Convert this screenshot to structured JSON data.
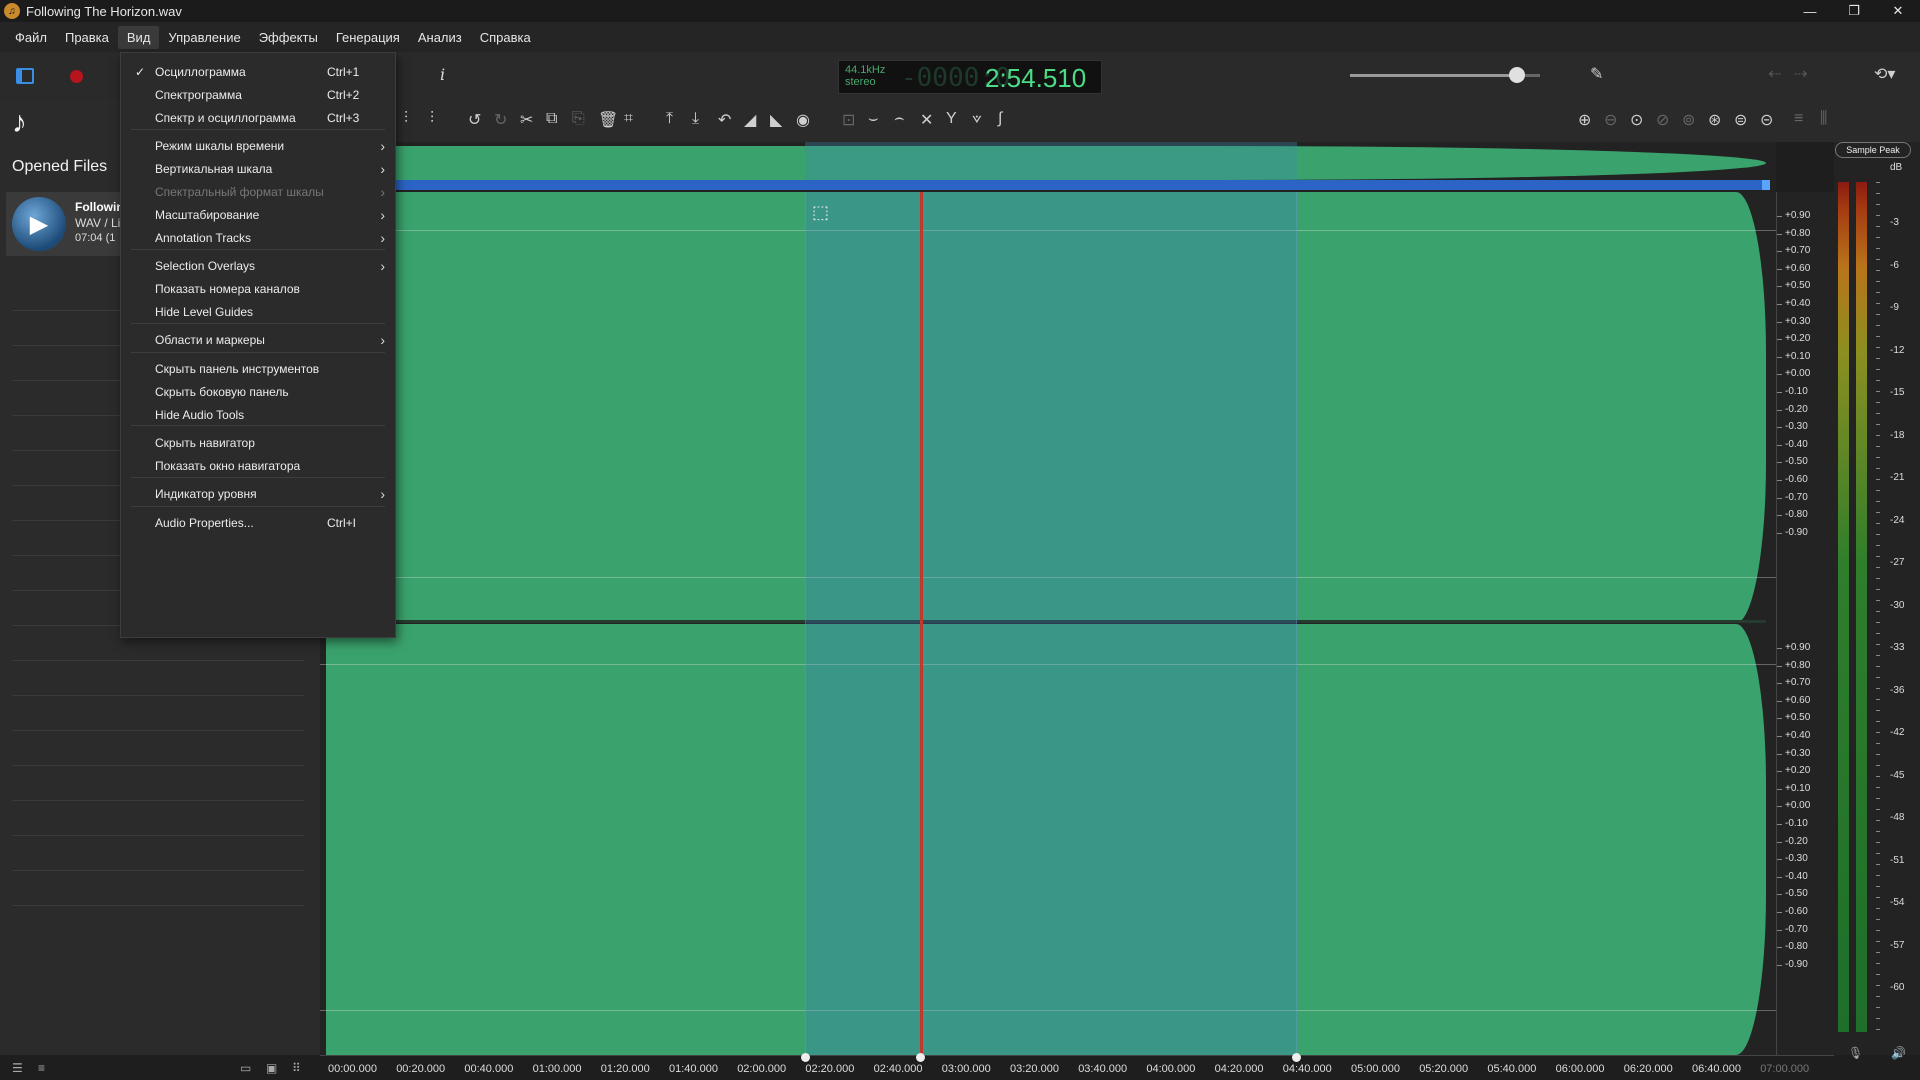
{
  "window": {
    "title": "Following The Horizon.wav",
    "buttons": [
      "—",
      "❐",
      "✕"
    ]
  },
  "menubar": {
    "items": [
      "Файл",
      "Правка",
      "Вид",
      "Управление",
      "Эффекты",
      "Генерация",
      "Анализ",
      "Справка"
    ]
  },
  "view_menu": {
    "items": [
      {
        "label": "Осциллограмма",
        "shortcut": "Ctrl+1",
        "checked": true
      },
      {
        "label": "Спектрограмма",
        "shortcut": "Ctrl+2"
      },
      {
        "label": "Спектр и осциллограмма",
        "shortcut": "Ctrl+3"
      },
      {
        "label": "Режим шкалы времени",
        "submenu": true
      },
      {
        "label": "Вертикальная шкала",
        "submenu": true
      },
      {
        "label": "Спектральный формат шкалы",
        "submenu": true,
        "disabled": true
      },
      {
        "label": "Масштабирование",
        "submenu": true
      },
      {
        "label": "Annotation Tracks",
        "submenu": true
      },
      {
        "label": "Selection Overlays",
        "submenu": true
      },
      {
        "label": "Показать номера каналов"
      },
      {
        "label": "Hide Level Guides"
      },
      {
        "label": "Области и маркеры",
        "submenu": true
      },
      {
        "label": "Скрыть панель инструментов"
      },
      {
        "label": "Скрыть боковую панель"
      },
      {
        "label": "Hide Audio Tools"
      },
      {
        "label": "Скрыть навигатор"
      },
      {
        "label": "Показать окно навигатора"
      },
      {
        "label": "Индикатор уровня",
        "submenu": true
      },
      {
        "label": "Audio Properties...",
        "shortcut": "Ctrl+I"
      }
    ]
  },
  "sidebar": {
    "header": "Opened Files",
    "file": {
      "name": "Followin",
      "meta": "WAV / Li",
      "duration": "07:04 (1"
    }
  },
  "transport": {
    "sample_rate": "44.1kHz",
    "channels": "stereo",
    "ghost_digits": "-0000:0",
    "time": "2:54.510",
    "volume": 0.88,
    "info_label": "i"
  },
  "icons": {
    "music": "♪",
    "play": "▶",
    "arrow": "›",
    "check": "✓",
    "brush": "✎",
    "history": "⟲▾",
    "back": "⇠",
    "forward": "⇢",
    "toolbar": [
      "⫶",
      "⫶",
      "↺",
      "↻",
      "✂",
      "⧉",
      "⎘",
      "🗑",
      "⌗",
      "⤒",
      "⤓",
      "↶",
      "◢",
      "◣",
      "◉",
      "⊡",
      "⌣",
      "⌢",
      "✕",
      "Y",
      "⟇",
      "∫"
    ],
    "zoom": [
      "⊕",
      "⊖",
      "⊙",
      "⊘",
      "⊚",
      "⊛",
      "⊜",
      "⊝",
      "≡",
      "⫼"
    ],
    "mic": "🎙",
    "speaker": "🔊",
    "selection": "⬚"
  },
  "vscale_top": [
    "+0.90",
    "+0.80",
    "+0.70",
    "+0.60",
    "+0.50",
    "+0.40",
    "+0.30",
    "+0.20",
    "+0.10",
    "+0.00",
    "-0.10",
    "-0.20",
    "-0.30",
    "-0.40",
    "-0.50",
    "-0.60",
    "-0.70",
    "-0.80",
    "-0.90"
  ],
  "vscale_bottom": [
    "+0.90",
    "+0.80",
    "+0.70",
    "+0.60",
    "+0.50",
    "+0.40",
    "+0.30",
    "+0.20",
    "+0.10",
    "+0.00",
    "-0.10",
    "-0.20",
    "-0.30",
    "-0.40",
    "-0.50",
    "-0.60",
    "-0.70",
    "-0.80",
    "-0.90"
  ],
  "meter": {
    "header": "Sample Peak",
    "unit": "dB",
    "ticks": [
      "-3",
      "-6",
      "-9",
      "-12",
      "-15",
      "-18",
      "-21",
      "-24",
      "-27",
      "-30",
      "-33",
      "-36",
      "-42",
      "-45",
      "-48",
      "-51",
      "-54",
      "-57",
      "-60"
    ]
  },
  "timeline": {
    "labels": [
      "00:00.000",
      "00:20.000",
      "00:40.000",
      "01:00.000",
      "01:20.000",
      "01:40.000",
      "02:00.000",
      "02:20.000",
      "02:40.000",
      "03:00.000",
      "03:20.000",
      "03:40.000",
      "04:00.000",
      "04:20.000",
      "04:40.000",
      "05:00.000",
      "05:20.000",
      "05:40.000",
      "06:00.000",
      "06:20.000",
      "06:40.000",
      "07:00.000"
    ]
  },
  "colors": {
    "waveform": "#3aa26d",
    "selection": "#3c78c8",
    "cursor": "#c0392b",
    "time_display": "#4ddc86"
  }
}
